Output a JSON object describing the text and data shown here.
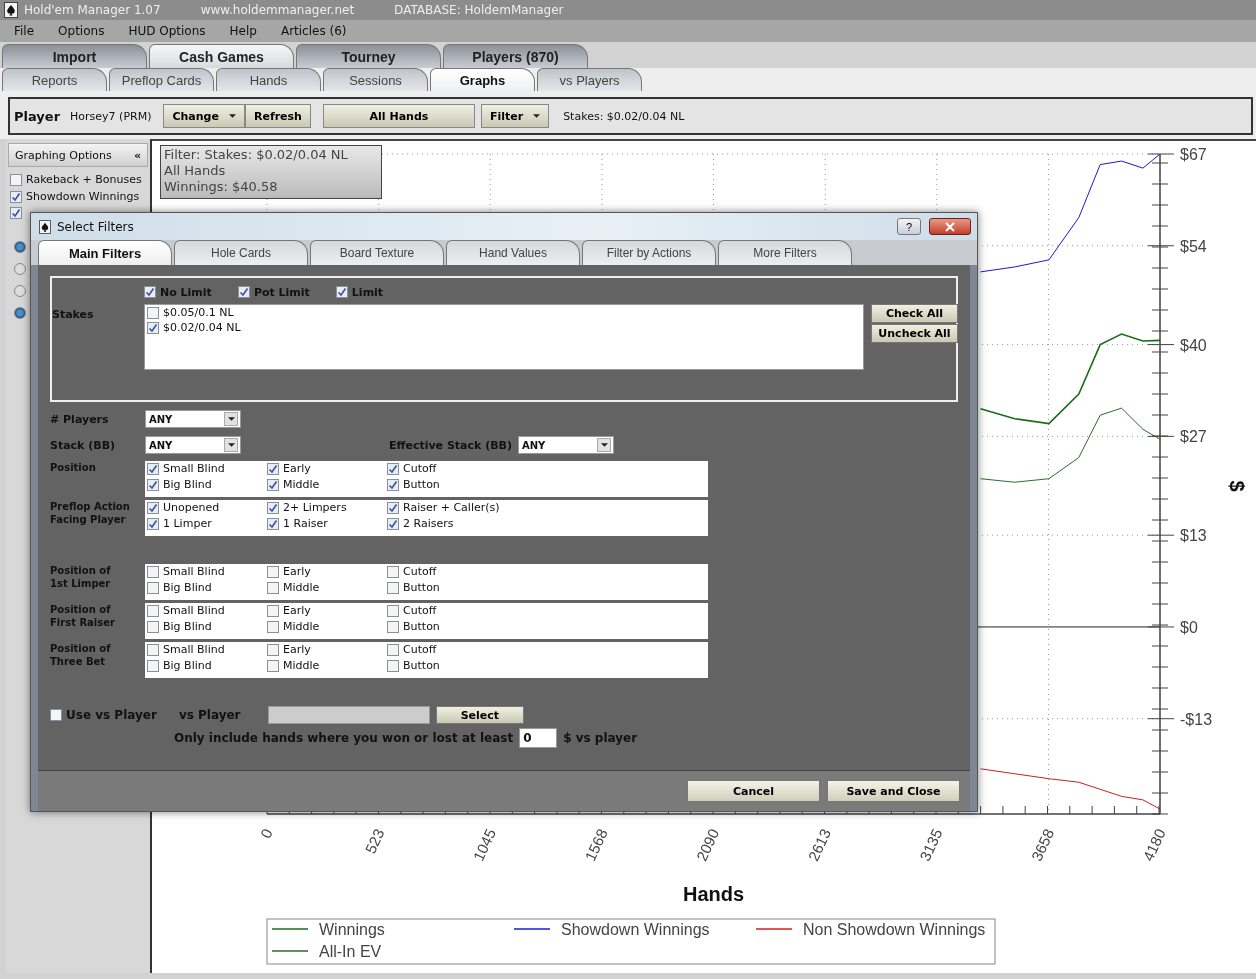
{
  "window": {
    "title": "Hold'em Manager 1.07",
    "url": "www.holdemmanager.net",
    "database": "DATABASE: HoldemManager"
  },
  "menu": [
    "File",
    "Options",
    "HUD Options",
    "Help",
    "Articles (6)"
  ],
  "main_tabs": [
    {
      "label": "Import",
      "selected": false
    },
    {
      "label": "Cash Games",
      "selected": true
    },
    {
      "label": "Tourney",
      "selected": false
    },
    {
      "label": "Players (870)",
      "selected": false
    }
  ],
  "sub_tabs": [
    {
      "label": "Reports",
      "selected": false
    },
    {
      "label": "Preflop Cards",
      "selected": false
    },
    {
      "label": "Hands",
      "selected": false
    },
    {
      "label": "Sessions",
      "selected": false
    },
    {
      "label": "Graphs",
      "selected": true
    },
    {
      "label": "vs Players",
      "selected": false
    }
  ],
  "toolbar": {
    "player_label": "Player",
    "player": "Horsey7 (PRM)",
    "buttons": [
      {
        "label": "Change",
        "kind": "dropdown"
      },
      {
        "label": "Refresh",
        "kind": "plain"
      },
      {
        "label": "All Hands",
        "kind": "wide"
      },
      {
        "label": "Filter",
        "kind": "dropdown"
      }
    ],
    "stakes": "Stakes: $0.02/0.04 NL"
  },
  "sidebar": {
    "title": "Graphing Options",
    "collapse": "«",
    "checkboxes": [
      {
        "label": "Rakeback + Bonuses",
        "checked": false
      },
      {
        "label": "Showdown Winnings",
        "checked": true
      },
      {
        "checked": true
      }
    ],
    "radios": [
      {
        "selected": true
      },
      {
        "selected": false
      },
      {
        "selected": false
      },
      {
        "selected": true
      }
    ]
  },
  "chart_info": [
    "Filter: Stakes: $0.02/0.04 NL",
    "All Hands",
    "Winnings: $40.58"
  ],
  "chart": {
    "chart_data": {
      "type": "line",
      "xlabel": "Hands",
      "ylabel": "$",
      "x": [
        3340,
        3500,
        3660,
        3800,
        3900,
        4000,
        4100,
        4180
      ],
      "series": [
        {
          "name": "Winnings",
          "color": "#1a6b1a",
          "values": [
            30.9,
            29.5,
            28.8,
            33,
            40,
            41.5,
            40.5,
            40.6
          ]
        },
        {
          "name": "All-In EV",
          "color": "#2e6b2e",
          "values": [
            21,
            20.5,
            21,
            24,
            30,
            31,
            28,
            26.6
          ]
        },
        {
          "name": "Showdown Winnings",
          "color": "#1a1ad0",
          "values": [
            50.3,
            51,
            52,
            58,
            65.5,
            66,
            65,
            67
          ]
        },
        {
          "name": "Non Showdown Winnings",
          "color": "#d02020",
          "values": [
            -20.1,
            -20.8,
            -21.5,
            -22,
            -23,
            -24,
            -24.5,
            -25.8
          ]
        }
      ],
      "xlim": [
        0,
        4180
      ],
      "ylim": [
        -26.5,
        67
      ],
      "grid": true,
      "legend": true,
      "xticks": [
        {
          "value": 0,
          "label": "0"
        },
        523,
        1045,
        1568,
        2090,
        2613,
        3135,
        3658,
        4180
      ],
      "yticks": [
        {
          "value": 67,
          "label": "$67"
        },
        {
          "value": 54,
          "label": "$54"
        },
        {
          "value": 40,
          "label": "$40"
        },
        {
          "value": 27,
          "label": "$27"
        },
        {
          "value": 13,
          "label": "$13"
        },
        {
          "value": 0,
          "label": "$0"
        },
        {
          "value": -13,
          "label": "-$13"
        }
      ]
    }
  },
  "dialog": {
    "title": "Select Filters",
    "help": "?",
    "tabs": [
      {
        "label": "Main Filters",
        "selected": true
      },
      {
        "label": "Hole Cards",
        "selected": false
      },
      {
        "label": "Board Texture",
        "selected": false
      },
      {
        "label": "Hand Values",
        "selected": false
      },
      {
        "label": "Filter by Actions",
        "selected": false
      },
      {
        "label": "More Filters",
        "selected": false
      }
    ],
    "limits": [
      {
        "label": "No Limit",
        "checked": true
      },
      {
        "label": "Pot Limit",
        "checked": true
      },
      {
        "label": "Limit",
        "checked": true
      }
    ],
    "stakes_label": "Stakes",
    "stakes": [
      {
        "label": "$0.05/0.1 NL",
        "checked": false
      },
      {
        "label": "$0.02/0.04 NL",
        "checked": true
      }
    ],
    "stake_buttons": [
      "Check All",
      "Uncheck All"
    ],
    "dropdowns": [
      {
        "label": "# Players",
        "value": "ANY"
      },
      {
        "label": "Stack (BB)",
        "value": "ANY"
      },
      {
        "label": "Effective Stack (BB)",
        "value": "ANY"
      }
    ],
    "groups": [
      {
        "label": [
          "Position"
        ],
        "options": [
          {
            "label": "Small Blind",
            "checked": true
          },
          {
            "label": "Early",
            "checked": true
          },
          {
            "label": "Cutoff",
            "checked": true
          },
          {
            "label": "Big Blind",
            "checked": true
          },
          {
            "label": "Middle",
            "checked": true
          },
          {
            "label": "Button",
            "checked": true
          }
        ]
      },
      {
        "label": [
          "Preflop Action",
          "Facing Player"
        ],
        "options": [
          {
            "label": "Unopened",
            "checked": true
          },
          {
            "label": "2+ Limpers",
            "checked": true
          },
          {
            "label": "Raiser + Caller(s)",
            "checked": true
          },
          {
            "label": "1 Limper",
            "checked": true
          },
          {
            "label": "1 Raiser",
            "checked": true
          },
          {
            "label": "2 Raisers",
            "checked": true
          }
        ]
      },
      {
        "label": [
          "Position of",
          "1st Limper"
        ],
        "options": [
          {
            "label": "Small Blind",
            "checked": false
          },
          {
            "label": "Early",
            "checked": false
          },
          {
            "label": "Cutoff",
            "checked": false
          },
          {
            "label": "Big Blind",
            "checked": false
          },
          {
            "label": "Middle",
            "checked": false
          },
          {
            "label": "Button",
            "checked": false
          }
        ]
      },
      {
        "label": [
          "Position of",
          "First Raiser"
        ],
        "options": [
          {
            "label": "Small Blind",
            "checked": false
          },
          {
            "label": "Early",
            "checked": false
          },
          {
            "label": "Cutoff",
            "checked": false
          },
          {
            "label": "Big Blind",
            "checked": false
          },
          {
            "label": "Middle",
            "checked": false
          },
          {
            "label": "Button",
            "checked": false
          }
        ]
      },
      {
        "label": [
          "Position of",
          "Three Bet"
        ],
        "options": [
          {
            "label": "Small Blind",
            "checked": false
          },
          {
            "label": "Early",
            "checked": false
          },
          {
            "label": "Cutoff",
            "checked": false
          },
          {
            "label": "Big Blind",
            "checked": false
          },
          {
            "label": "Middle",
            "checked": false
          },
          {
            "label": "Button",
            "checked": false
          }
        ]
      }
    ],
    "vs_player": {
      "use_label": "Use vs Player",
      "checked": false,
      "field_label": "vs Player",
      "select": "Select",
      "min_label": "Only include hands where you won or lost at least",
      "min_value": "0",
      "suffix": "$ vs player"
    },
    "buttons": [
      "Cancel",
      "Save and Close"
    ]
  }
}
